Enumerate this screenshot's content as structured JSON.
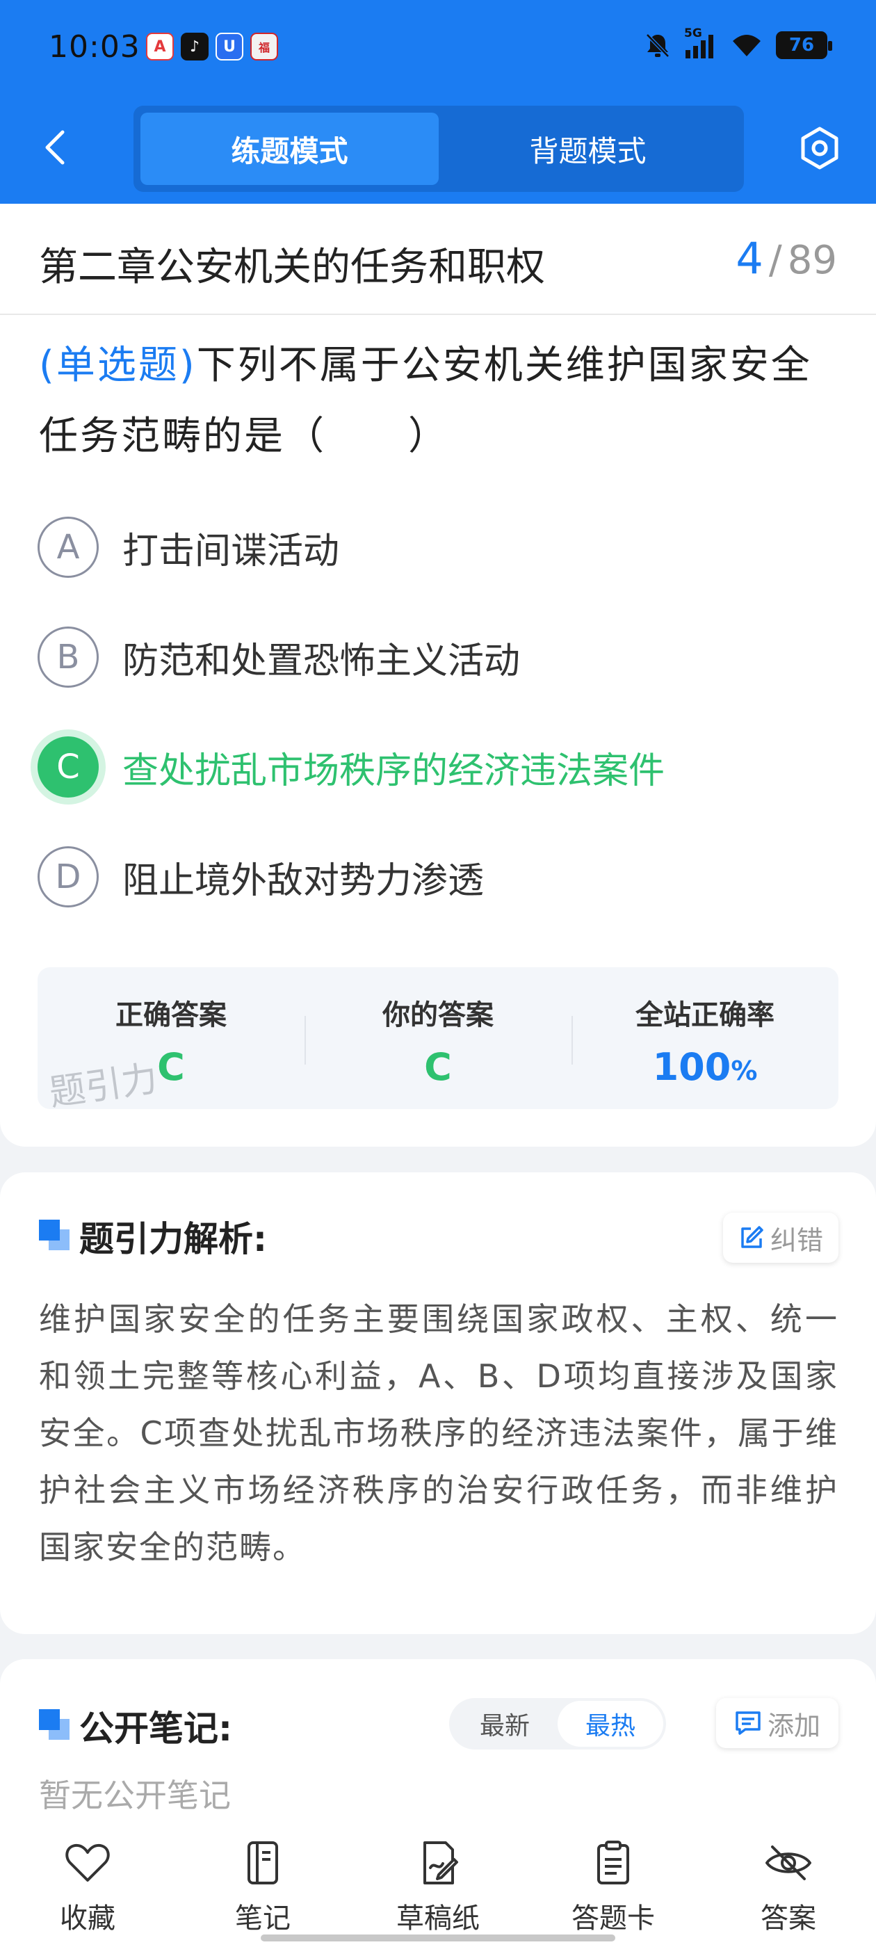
{
  "status_bar": {
    "time": "10:03",
    "app_icons": [
      "A",
      "♪",
      "U",
      "福"
    ],
    "network": "5G",
    "battery": "76"
  },
  "nav": {
    "tabs": [
      {
        "label": "练题模式",
        "active": true
      },
      {
        "label": "背题模式",
        "active": false
      }
    ],
    "back_icon": "chevron-left-icon",
    "settings_icon": "hexagon-settings-icon"
  },
  "chapter": {
    "title": "第二章公安机关的任务和职权",
    "current": "4",
    "separator": "/",
    "total": "89"
  },
  "question": {
    "type": "(单选题)",
    "text": "下列不属于公安机关维护国家安全任务范畴的是（　　）"
  },
  "options": [
    {
      "letter": "A",
      "text": "打击间谍活动",
      "state": "normal"
    },
    {
      "letter": "B",
      "text": "防范和处置恐怖主义活动",
      "state": "normal"
    },
    {
      "letter": "C",
      "text": "查处扰乱市场秩序的经济违法案件",
      "state": "correct"
    },
    {
      "letter": "D",
      "text": "阻止境外敌对势力渗透",
      "state": "normal"
    }
  ],
  "answer_summary": {
    "correct_label": "正确答案",
    "correct_value": "C",
    "yours_label": "你的答案",
    "yours_value": "C",
    "rate_label": "全站正确率",
    "rate_value": "100",
    "rate_unit": "%",
    "watermark": "题引力"
  },
  "analysis": {
    "title": "题引力解析:",
    "report_label": "纠错",
    "text": "维护国家安全的任务主要围绕国家政权、主权、统一和领土完整等核心利益，A、B、D项均直接涉及国家安全。C项查处扰乱市场秩序的经济违法案件，属于维护社会主义市场经济秩序的治安行政任务，而非维护国家安全的范畴。"
  },
  "notes": {
    "title": "公开笔记:",
    "sort_options": [
      {
        "label": "最新",
        "active": false
      },
      {
        "label": "最热",
        "active": true
      }
    ],
    "add_label": "添加",
    "empty_text": "暂无公开笔记"
  },
  "bottom_bar": [
    {
      "label": "收藏",
      "icon": "heart-icon"
    },
    {
      "label": "笔记",
      "icon": "notebook-icon"
    },
    {
      "label": "草稿纸",
      "icon": "draft-paper-icon"
    },
    {
      "label": "答题卡",
      "icon": "answer-card-icon"
    },
    {
      "label": "答案",
      "icon": "eye-off-icon"
    }
  ],
  "colors": {
    "primary": "#1b7cf2",
    "correct": "#2ec16f",
    "background": "#f1f3f6"
  }
}
